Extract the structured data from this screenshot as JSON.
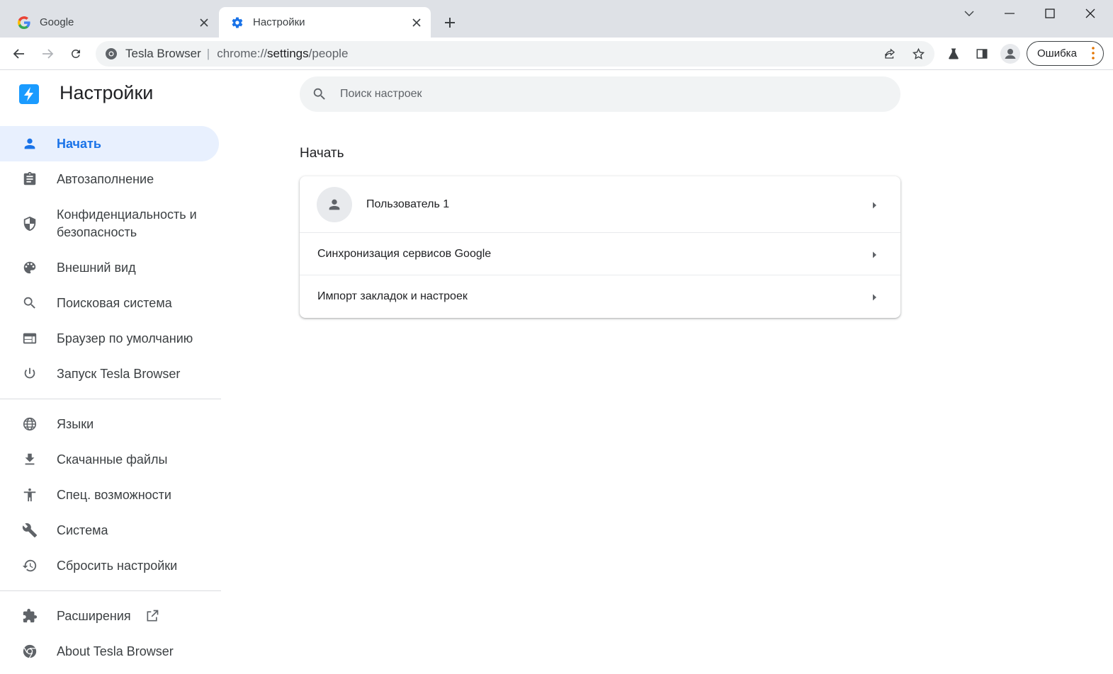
{
  "tabs": [
    {
      "title": "Google",
      "favicon": "google-g-icon"
    },
    {
      "title": "Настройки",
      "favicon": "gear-icon",
      "active": true
    }
  ],
  "toolbar": {
    "site_name": "Tesla Browser",
    "url_scheme": "chrome://",
    "url_host": "settings",
    "url_path": "/people",
    "error_label": "Ошибка"
  },
  "brand": {
    "title": "Настройки",
    "logo": "tesla-browser-logo"
  },
  "sidebar": {
    "items": [
      {
        "label": "Начать",
        "icon": "person-icon",
        "active": true
      },
      {
        "label": "Автозаполнение",
        "icon": "clipboard-icon"
      },
      {
        "label": "Конфиденциальность и безопасность",
        "icon": "shield-icon"
      },
      {
        "label": "Внешний вид",
        "icon": "palette-icon"
      },
      {
        "label": "Поисковая система",
        "icon": "search-icon"
      },
      {
        "label": "Браузер по умолчанию",
        "icon": "browser-window-icon"
      },
      {
        "label": "Запуск Tesla Browser",
        "icon": "power-icon"
      },
      {
        "label": "Языки",
        "icon": "globe-icon"
      },
      {
        "label": "Скачанные файлы",
        "icon": "download-icon"
      },
      {
        "label": "Спец. возможности",
        "icon": "accessibility-icon"
      },
      {
        "label": "Система",
        "icon": "wrench-icon"
      },
      {
        "label": "Сбросить настройки",
        "icon": "history-icon"
      },
      {
        "label": "Расширения",
        "icon": "puzzle-icon"
      },
      {
        "label": "About Tesla Browser",
        "icon": "chrome-logo-icon"
      }
    ]
  },
  "search": {
    "placeholder": "Поиск настроек"
  },
  "main": {
    "section_title": "Начать",
    "rows": [
      {
        "label": "Пользователь 1"
      },
      {
        "label": "Синхронизация сервисов Google"
      },
      {
        "label": "Импорт закладок и настроек"
      }
    ]
  },
  "colors": {
    "accent": "#1a73e8",
    "active_bg": "#e8f0fe",
    "tabstrip": "#dee1e6"
  }
}
